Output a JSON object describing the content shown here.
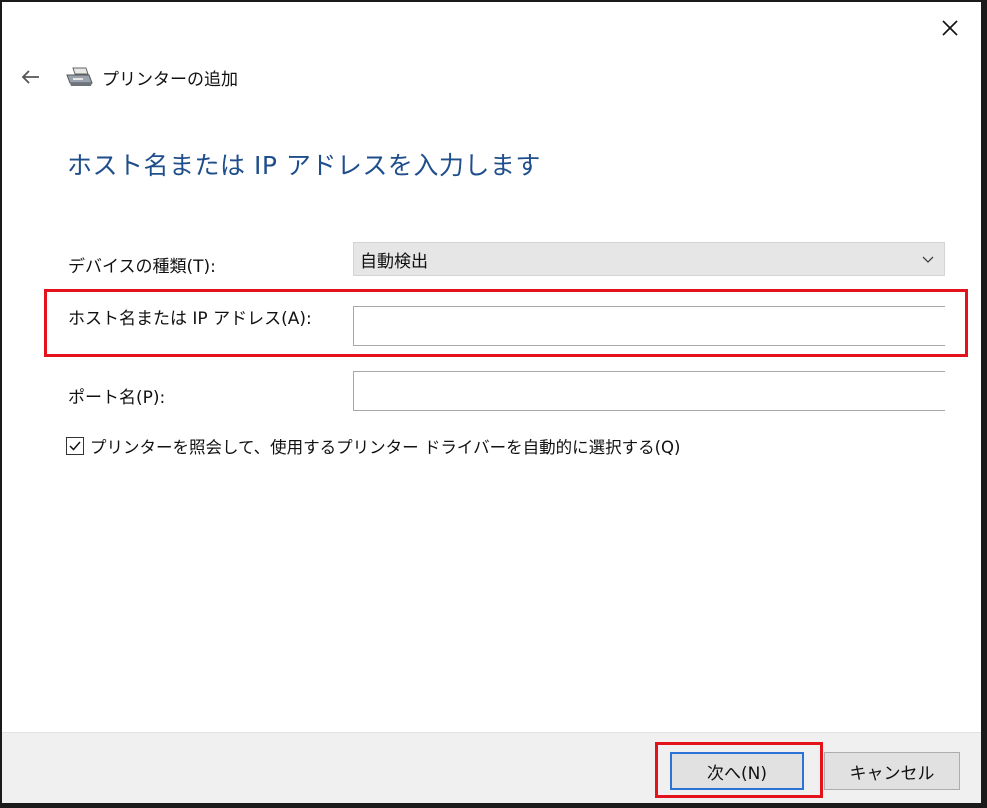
{
  "window": {
    "title": "プリンターの追加",
    "close_icon": "close-icon",
    "back_icon": "back-arrow-icon",
    "printer_icon": "printer-icon"
  },
  "heading": "ホスト名または IP アドレスを入力します",
  "form": {
    "device_type_label": "デバイスの種類(T):",
    "device_type_value": "自動検出",
    "hostname_label": "ホスト名または IP アドレス(A):",
    "hostname_value": "",
    "port_label": "ポート名(P):",
    "port_value": "",
    "auto_select_label": "プリンターを照会して、使用するプリンター ドライバーを自動的に選択する(Q)",
    "auto_select_checked": true
  },
  "buttons": {
    "next": "次へ(N)",
    "cancel": "キャンセル"
  },
  "colors": {
    "heading": "#1f4e8c",
    "highlight": "#e3121b",
    "primary_border": "#2b73d6"
  }
}
